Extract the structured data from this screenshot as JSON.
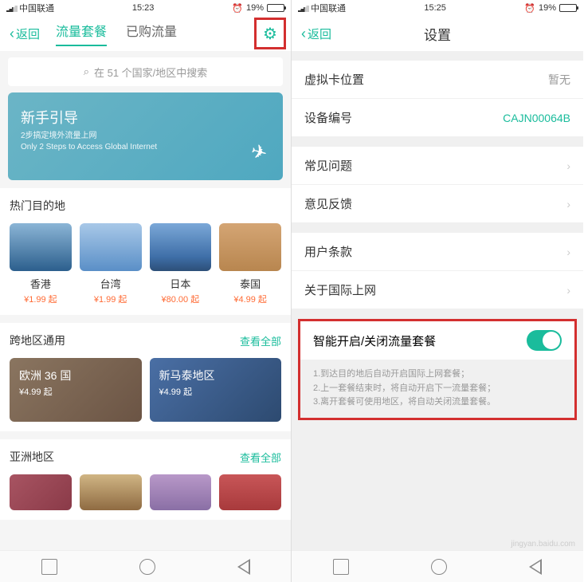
{
  "left": {
    "status": {
      "carrier": "中国联通",
      "time": "15:23",
      "battery": "19%"
    },
    "nav": {
      "back": "返回",
      "tab1": "流量套餐",
      "tab2": "已购流量"
    },
    "search": {
      "placeholder": "在 51 个国家/地区中搜索"
    },
    "banner": {
      "title": "新手引导",
      "line1": "2步搞定境外流量上网",
      "line2": "Only 2 Steps to Access Global Internet"
    },
    "hot": {
      "title": "热门目的地"
    },
    "dests": [
      {
        "name": "香港",
        "price": "¥1.99 起"
      },
      {
        "name": "台湾",
        "price": "¥1.99 起"
      },
      {
        "name": "日本",
        "price": "¥80.00 起"
      },
      {
        "name": "泰国",
        "price": "¥4.99 起"
      }
    ],
    "cross": {
      "title": "跨地区通用",
      "all": "查看全部"
    },
    "regions": [
      {
        "name": "欧洲 36 国",
        "price": "¥4.99 起"
      },
      {
        "name": "新马泰地区",
        "price": "¥4.99 起"
      }
    ],
    "asia": {
      "title": "亚洲地区",
      "all": "查看全部"
    }
  },
  "right": {
    "status": {
      "carrier": "中国联通",
      "time": "15:25",
      "battery": "19%"
    },
    "nav": {
      "back": "返回",
      "title": "设置"
    },
    "items": {
      "vcard": {
        "label": "虚拟卡位置",
        "value": "暂无"
      },
      "device": {
        "label": "设备编号",
        "value": "CAJN00064B"
      },
      "faq": {
        "label": "常见问题"
      },
      "feedback": {
        "label": "意见反馈"
      },
      "terms": {
        "label": "用户条款"
      },
      "about": {
        "label": "关于国际上网"
      },
      "smart": {
        "label": "智能开启/关闭流量套餐"
      }
    },
    "desc": {
      "l1": "1.到达目的地后自动开启国际上网套餐；",
      "l2": "2.上一套餐结束时，将自动开启下一流量套餐；",
      "l3": "3.离开套餐可使用地区，将自动关闭流量套餐。"
    }
  },
  "watermark": "jingyan.baidu.com"
}
